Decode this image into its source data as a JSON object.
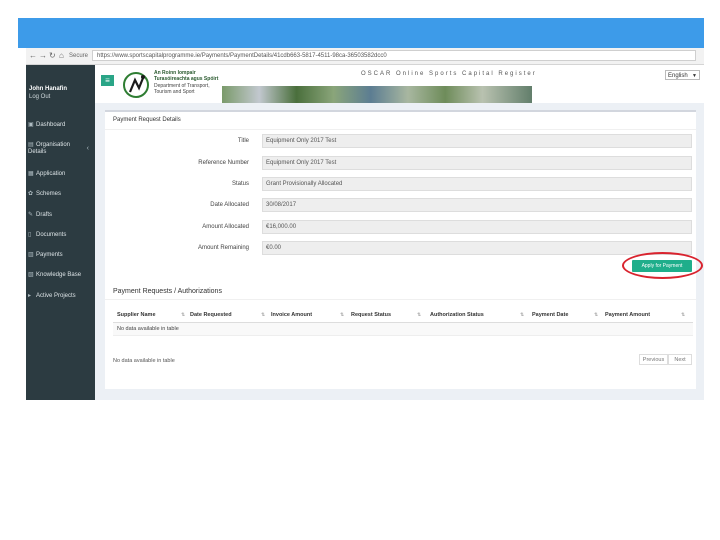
{
  "browser": {
    "nav_icons": [
      "back-arrow-icon",
      "forward-arrow-icon",
      "reload-icon",
      "home-icon"
    ],
    "secure_label": "Secure",
    "url": "https://www.sportscapitalprogramme.ie/Payments/PaymentDetails/41cdb663-5817-4511-98ca-36503582dcc0"
  },
  "sidebar": {
    "user_name": "John Hanafin",
    "logout_label": "Log Out",
    "items": [
      {
        "label": "Dashboard",
        "icon": "dashboard-icon"
      },
      {
        "label": "Organisation",
        "label2": "Details",
        "icon": "organisation-icon",
        "chevron": "‹"
      },
      {
        "label": "Application",
        "icon": "application-icon"
      },
      {
        "label": "Schemes",
        "icon": "schemes-icon"
      },
      {
        "label": "Drafts",
        "icon": "drafts-icon"
      },
      {
        "label": "Documents",
        "icon": "documents-icon"
      },
      {
        "label": "Payments",
        "icon": "payments-icon"
      },
      {
        "label": "Knowledge Base",
        "icon": "knowledge-base-icon"
      },
      {
        "label": "Active Projects",
        "icon": "active-projects-icon"
      }
    ]
  },
  "header": {
    "logo_line1": "An Roinn Iompair",
    "logo_line2": "Turasóireachta agus Spóirt",
    "logo_line3": "Department of Transport,",
    "logo_line4": "Tourism and Sport",
    "oscar_title": "OSCAR  Online Sports Capital Register",
    "language": "English"
  },
  "payment_details": {
    "title": "Payment Request Details",
    "fields": [
      {
        "label": "Title",
        "value": "Equipment Only 2017 Test"
      },
      {
        "label": "Reference Number",
        "value": "Equipment Only 2017 Test"
      },
      {
        "label": "Status",
        "value": "Grant Provisionally Allocated"
      },
      {
        "label": "Date Allocated",
        "value": "30/08/2017"
      },
      {
        "label": "Amount Allocated",
        "value": "€16,000.00"
      },
      {
        "label": "Amount Remaining",
        "value": "€0.00"
      }
    ],
    "apply_button": "Apply for Payment"
  },
  "requests": {
    "title": "Payment Requests / Authorizations",
    "columns": [
      "Supplier Name",
      "Date Requested",
      "Invoice Amount",
      "Request Status",
      "Authorization Status",
      "Payment Date",
      "Payment Amount"
    ],
    "empty_text": "No data available in table",
    "info_text": "No data available in table",
    "prev_label": "Previous",
    "next_label": "Next"
  },
  "colors": {
    "topbar": "#3d9be9",
    "sidebar": "#2c3b41",
    "accent_green": "#1fae8b",
    "highlight_red": "#d9232e"
  }
}
